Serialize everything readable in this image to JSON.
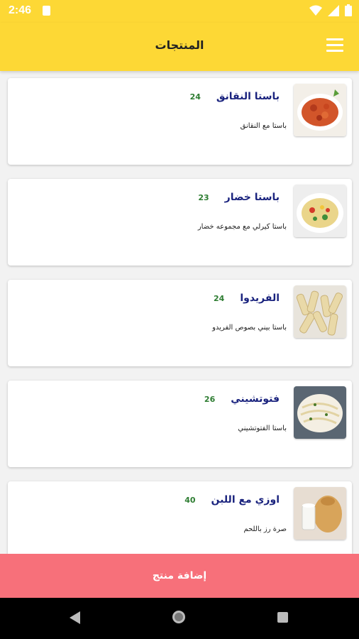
{
  "status": {
    "time": "2:46"
  },
  "header": {
    "title": "المنتجات"
  },
  "products": [
    {
      "name": "باستا النقانق",
      "price": "24",
      "description": "باستا مع النقانق"
    },
    {
      "name": "باستا خضار",
      "price": "23",
      "description": "باستا كيرلي مع مجموعه خضار"
    },
    {
      "name": "الفريدوا",
      "price": "24",
      "description": "باستا بيني بصوص الفريدو"
    },
    {
      "name": "فتوتشيني",
      "price": "26",
      "description": "باستا الفتوتشيني"
    },
    {
      "name": "اوزي مع اللبن",
      "price": "40",
      "description": "صرة رز باللحم"
    }
  ],
  "footer": {
    "add_label": "إضافة منتج"
  },
  "colors": {
    "accent": "#fdd835",
    "button": "#f7707a",
    "price": "#2e7d32",
    "name": "#1a237e"
  },
  "icons": {
    "menu": "hamburger-menu-icon",
    "back": "nav-back-icon",
    "home": "nav-home-icon",
    "recent": "nav-recent-icon"
  }
}
